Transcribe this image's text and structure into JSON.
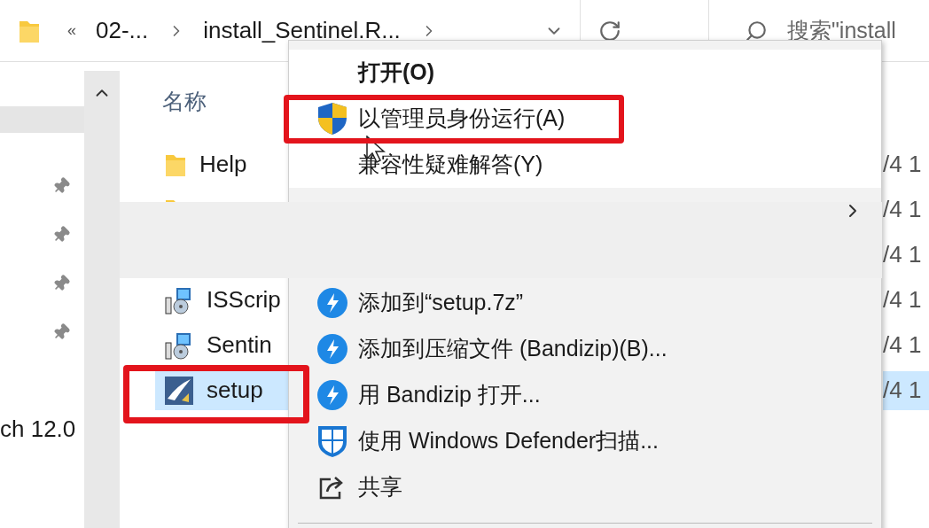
{
  "address_bar": {
    "back_label": "«",
    "crumbs": [
      "02-...",
      "install_Sentinel.R..."
    ],
    "search_placeholder": "搜索\"install"
  },
  "nav": {
    "item_label": "ch 12.0"
  },
  "file_list": {
    "column_name": "名称",
    "files": [
      {
        "kind": "folder",
        "name": "Help",
        "date": "/4 1",
        "selected": false,
        "annotated": false
      },
      {
        "kind": "folder",
        "date": "/4 1"
      },
      {
        "kind": "none",
        "date": "/4 1"
      },
      {
        "kind": "installer",
        "name": "ISScrip",
        "date": "/4 1",
        "selected": false,
        "annotated": false
      },
      {
        "kind": "installer",
        "name": "Sentin",
        "date": "/4 1",
        "selected": false,
        "annotated": false
      },
      {
        "kind": "setup",
        "name": "setup",
        "date": "/4 1",
        "selected": true,
        "annotated": true
      }
    ]
  },
  "context_menu": {
    "items": [
      {
        "kind": "plain",
        "label": "打开(O)",
        "bold": true,
        "annotated": false
      },
      {
        "kind": "uac",
        "label": "以管理员身份运行(A)",
        "bold": false,
        "annotated": true
      },
      {
        "kind": "plain",
        "label": "兼容性疑难解答(Y)",
        "bold": false,
        "annotated": false
      },
      {
        "kind": "submenu"
      },
      {
        "kind": "bandizip",
        "label": "添加到“setup.7z”",
        "bold": false,
        "annotated": false
      },
      {
        "kind": "bandizip",
        "label": "添加到压缩文件 (Bandizip)(B)...",
        "bold": false,
        "annotated": false
      },
      {
        "kind": "bandizip",
        "label": "用 Bandizip 打开...",
        "bold": false,
        "annotated": false
      },
      {
        "kind": "defender",
        "label": "使用 Windows Defender扫描...",
        "bold": false,
        "annotated": false
      },
      {
        "kind": "share",
        "label": "共享",
        "bold": false,
        "annotated": false
      }
    ]
  }
}
